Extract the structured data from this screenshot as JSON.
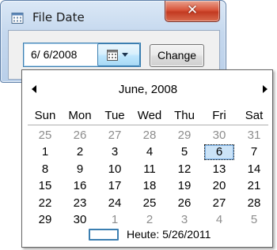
{
  "window": {
    "title": "File Date",
    "close_glyph": "✕",
    "icon": "calendar-app-icon"
  },
  "form": {
    "date_value": "6/  6/2008",
    "dropdown_icon": "calendar-dropdown-icon",
    "change_label": "Change"
  },
  "calendar": {
    "month_title": "June, 2008",
    "weekdays": [
      "Sun",
      "Mon",
      "Tue",
      "Wed",
      "Thu",
      "Fri",
      "Sat"
    ],
    "weeks": [
      [
        "25",
        "26",
        "27",
        "28",
        "29",
        "30",
        "31"
      ],
      [
        "1",
        "2",
        "3",
        "4",
        "5",
        "6",
        "7"
      ],
      [
        "8",
        "9",
        "10",
        "11",
        "12",
        "13",
        "14"
      ],
      [
        "15",
        "16",
        "17",
        "18",
        "19",
        "20",
        "21"
      ],
      [
        "22",
        "23",
        "24",
        "25",
        "26",
        "27",
        "28"
      ],
      [
        "29",
        "30",
        "1",
        "2",
        "3",
        "4",
        "5"
      ]
    ],
    "selected_day": "6",
    "today_label": "Heute: 5/26/2011",
    "colors": {
      "other_month": "#8d8d8d",
      "selection": "#cbe3f7",
      "accent": "#3c7fb1"
    }
  }
}
